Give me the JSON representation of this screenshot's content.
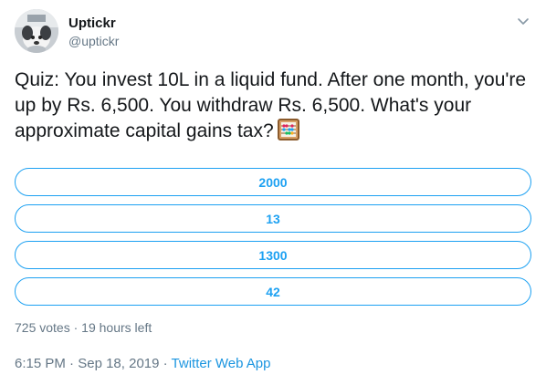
{
  "user": {
    "display_name": "Uptickr",
    "handle": "@uptickr",
    "avatar_icon": "dog-avatar-icon"
  },
  "tweet": {
    "text": "Quiz: You invest 10L in a liquid fund. After one month, you're up by Rs. 6,500. You withdraw Rs. 6,500. What's your approximate capital gains tax?",
    "emoji_icon": "abacus-icon"
  },
  "poll": {
    "options": [
      {
        "label": "2000"
      },
      {
        "label": "13"
      },
      {
        "label": "1300"
      },
      {
        "label": "42"
      }
    ],
    "votes": "725 votes",
    "separator": "·",
    "time_left": "19 hours left"
  },
  "meta": {
    "time": "6:15 PM",
    "separator1": "·",
    "date": "Sep 18, 2019",
    "separator2": "·",
    "source": "Twitter Web App"
  },
  "colors": {
    "accent": "#1da1f2",
    "link": "#1b95e0",
    "muted": "#657786",
    "text": "#14171a"
  }
}
